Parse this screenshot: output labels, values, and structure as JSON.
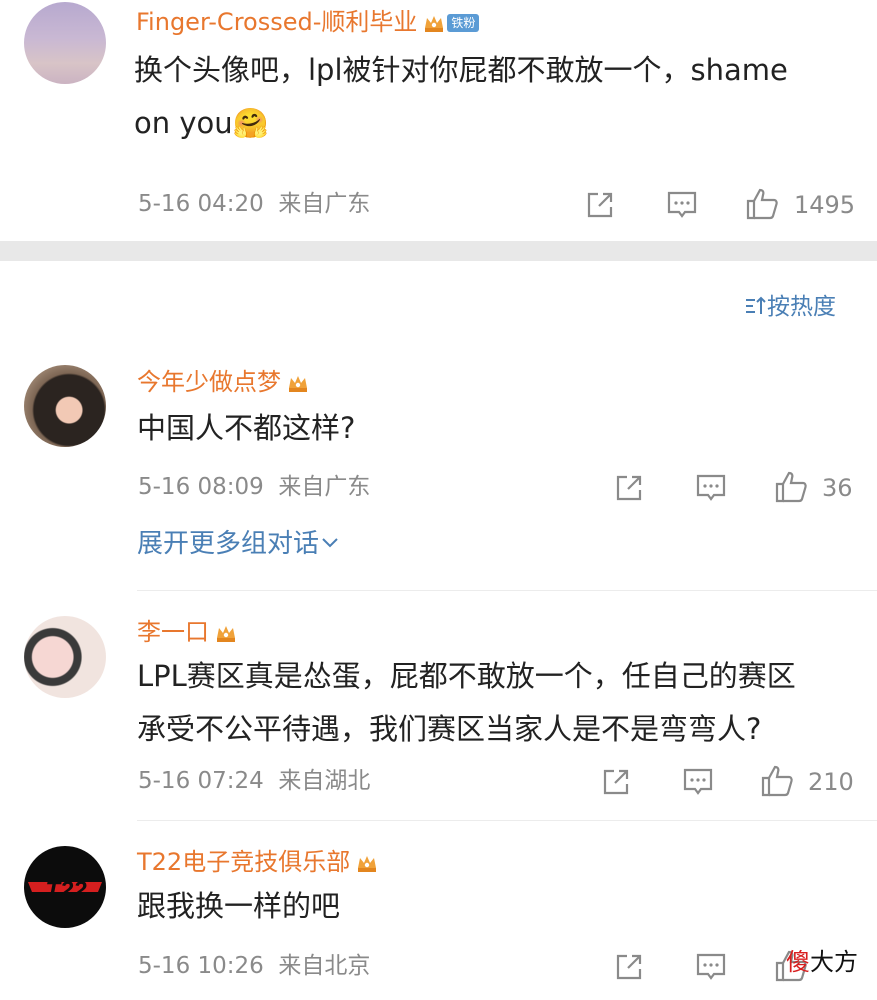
{
  "comments": [
    {
      "username": "Finger-Crossed-顺利毕业",
      "badge": "铁粉",
      "text_line1": "换个头像吧，lpl被针对你屁都不敢放一个，shame",
      "text_line2": "on you🤗",
      "time": "5-16 04:20",
      "location": "来自广东",
      "likes": "1495"
    },
    {
      "username": "今年少做点梦",
      "text_line1": "中国人不都这样?",
      "time": "5-16 08:09",
      "location": "来自广东",
      "likes": "36"
    },
    {
      "username": "李一口",
      "text_line1": "LPL赛区真是怂蛋，屁都不敢放一个，任自己的赛区",
      "text_line2": "承受不公平待遇，我们赛区当家人是不是弯弯人?",
      "time": "5-16 07:24",
      "location": "来自湖北",
      "likes": "210"
    },
    {
      "username": "T22电子竞技俱乐部",
      "text_line1": "跟我换一样的吧",
      "time": "5-16 10:26",
      "location": "来自北京",
      "likes": ""
    }
  ],
  "sort_label": "按热度",
  "expand_label": "展开更多组对话",
  "avatar_logo_text": "T22",
  "watermark": {
    "part1": "傻",
    "part2": "大方"
  },
  "colors": {
    "username": "#e8772e",
    "link": "#4a7fb5",
    "meta": "#8a8a8a"
  },
  "icons": [
    "share-icon",
    "comment-icon",
    "like-icon",
    "crown-icon",
    "sort-icon",
    "chevron-down-icon"
  ]
}
